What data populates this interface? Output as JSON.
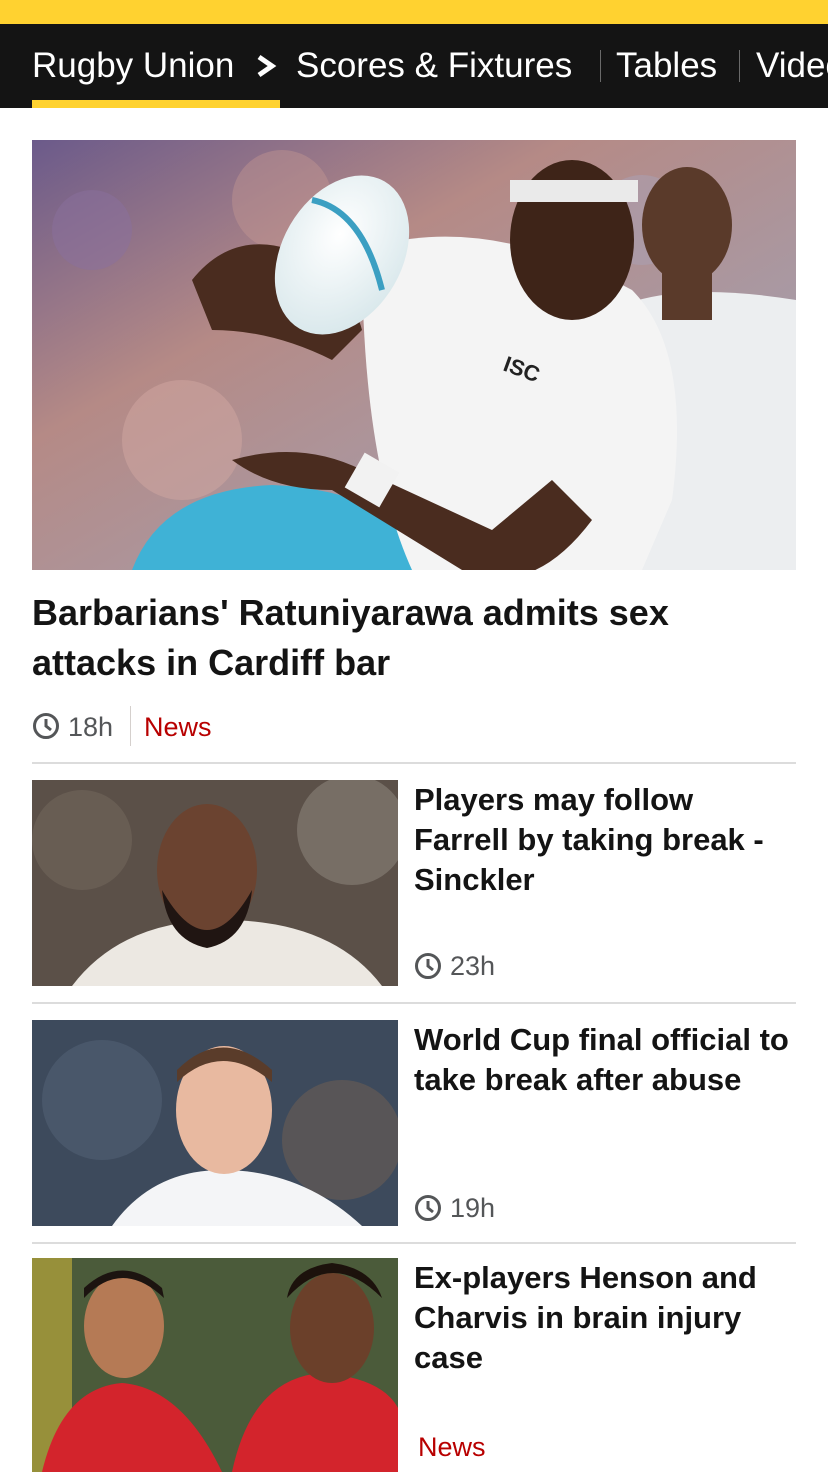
{
  "nav": {
    "items": [
      "Rugby Union",
      "Scores & Fixtures",
      "Tables",
      "Video"
    ],
    "active_index": 0,
    "accent": "#ffd230"
  },
  "lead": {
    "title": "Barbarians' Ratuniyarawa admits sex attacks in Cardiff bar",
    "time": "18h",
    "tag": "News"
  },
  "stories": [
    {
      "title": "Players may follow Farrell by taking break - Sinckler",
      "time": "23h"
    },
    {
      "title": "World Cup final official to take break after abuse",
      "time": "19h"
    },
    {
      "title": "Ex-players Henson and Charvis in brain injury case",
      "tag": "News"
    }
  ],
  "colors": {
    "tag": "#b80000",
    "nav_bg": "#141414"
  }
}
